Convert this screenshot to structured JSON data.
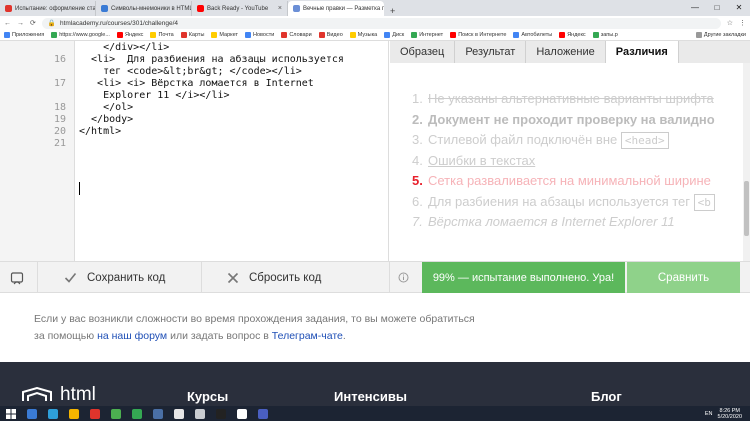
{
  "browser": {
    "tabs": [
      {
        "title": "Испытание: оформление стати...",
        "color": "#e0342c",
        "active": false
      },
      {
        "title": "Символы-мнемоники в HTML...",
        "color": "#3a7bd5",
        "active": false
      },
      {
        "title": "Back Ready - YouTube",
        "color": "#ff0000",
        "active": false
      },
      {
        "title": "Вечные правки — Разметка по...",
        "color": "#6b8fd6",
        "active": true
      }
    ],
    "window_controls": [
      "—",
      "□",
      "✕"
    ],
    "url": "htmlacademy.ru/courses/301/challenge/4",
    "bookmarks": [
      {
        "label": "Приложения",
        "color": "#4285f4"
      },
      {
        "label": "https://www.google...",
        "color": "#34a853"
      },
      {
        "label": "Яндекс",
        "color": "#ff0000"
      },
      {
        "label": "Почта",
        "color": "#ffcc00"
      },
      {
        "label": "Карты",
        "color": "#e0342c"
      },
      {
        "label": "Маркет",
        "color": "#ffcc00"
      },
      {
        "label": "Новости",
        "color": "#4285f4"
      },
      {
        "label": "Словари",
        "color": "#e0342c"
      },
      {
        "label": "Видео",
        "color": "#e0342c"
      },
      {
        "label": "Музыка",
        "color": "#ffcc00"
      },
      {
        "label": "Диск",
        "color": "#4285f4"
      },
      {
        "label": "Интернет",
        "color": "#34a853"
      },
      {
        "label": "Поиск в Интернете",
        "color": "#ff0000"
      },
      {
        "label": "Автобилеты",
        "color": "#4285f4"
      },
      {
        "label": "Яндекс",
        "color": "#ff0000"
      },
      {
        "label": "запы.р",
        "color": "#34a853"
      },
      {
        "label": "Другие закладки",
        "color": "#999999"
      }
    ]
  },
  "editor": {
    "lines": [
      {
        "num": "",
        "code": "    </div></li>"
      },
      {
        "num": "16",
        "code": "  <li>  Для разбиения на абзацы используется"
      },
      {
        "num": "",
        "code": "    тег <code>&lt;br&gt; </code></li>"
      },
      {
        "num": "17",
        "code": "   <li> <i> Вёрстка ломается в Internet"
      },
      {
        "num": "",
        "code": "    Explorer 11 </i></li>"
      },
      {
        "num": "18",
        "code": "    </ol>"
      },
      {
        "num": "19",
        "code": "  </body>"
      },
      {
        "num": "20",
        "code": "</html>"
      },
      {
        "num": "21",
        "code": ""
      }
    ]
  },
  "results": {
    "tabs": [
      "Образец",
      "Результат",
      "Наложение",
      "Различия",
      "?"
    ],
    "active_tab": "Различия",
    "items": [
      {
        "num": "1.",
        "text": "Не указаны альтернативные варианты шрифта",
        "style": "struck"
      },
      {
        "num": "2.",
        "text": "Документ не проходит проверку на валидно",
        "style": "bold"
      },
      {
        "num": "3.",
        "text": "Стилевой файл подключён вне",
        "tag": "<head>",
        "style": "plain"
      },
      {
        "num": "4.",
        "text": "Ошибки в текстах",
        "style": "under"
      },
      {
        "num": "5.",
        "text": "Сетка разваливается на минимальной ширине",
        "style": "red"
      },
      {
        "num": "6.",
        "text": "Для разбиения на абзацы используется тег",
        "tag": "<b",
        "style": "plain"
      },
      {
        "num": "7.",
        "text": "Вёрстка ломается в Internet Explorer 11",
        "style": "ital"
      }
    ]
  },
  "actions": {
    "save": "Сохранить код",
    "reset": "Сбросить код",
    "status": "99% — испытание выполнено. Ура!",
    "compare": "Сравнить"
  },
  "help": {
    "line1": "Если у вас возникли сложности во время прохождения задания, то вы можете обратиться",
    "line2_prefix": "за помощью ",
    "forum_link": "на наш форум",
    "line2_middle": " или задать вопрос в ",
    "telegram_link": "Телеграм-чате",
    "line2_suffix": "."
  },
  "footer": {
    "logo": "html",
    "columns": [
      "Курсы",
      "Интенсивы",
      "Блог"
    ]
  },
  "taskbar": {
    "lang": "EN",
    "time": "8:26 PM",
    "date": "5/20/2020",
    "apps": [
      "#3a7bd5",
      "#2e9fd9",
      "#f4b400",
      "#e0342c",
      "#4caf50",
      "#34a853",
      "#4a6fa5",
      "#e6e6e6",
      "#c9ccd1",
      "#222222",
      "#ffffff",
      "#4a5fc1"
    ]
  }
}
